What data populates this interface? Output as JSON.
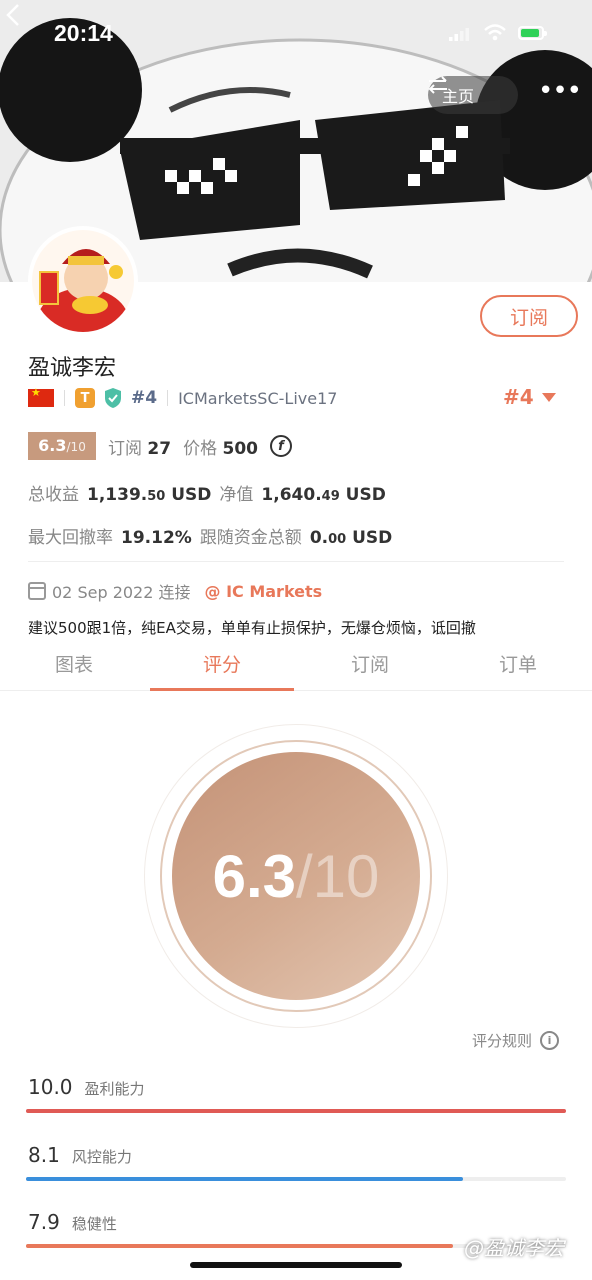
{
  "status_bar": {
    "time": "20:14"
  },
  "nav": {
    "home_label": "主页"
  },
  "profile": {
    "subscribe_label": "订阅",
    "name": "盈诚李宏",
    "rank_small": "#4",
    "server": "ICMarketsSC-Live17",
    "rank_big": "#4",
    "tier_badge": "T"
  },
  "stats": {
    "score": "6.3",
    "score_den": "/10",
    "subs_label": "订阅",
    "subs_value": "27",
    "price_label": "价格",
    "price_value": "500",
    "coin_symbol": "f",
    "total_income_label": "总收益",
    "total_income_int": "1,139.",
    "total_income_dec": "50",
    "currency": "USD",
    "net_label": "净值",
    "net_int": "1,640.",
    "net_dec": "49",
    "max_dd_label": "最大回撤率",
    "max_dd_value": "19.12%",
    "follow_label": "跟随资金总额",
    "follow_int": "0.",
    "follow_dec": "00"
  },
  "connection": {
    "date": "02 Sep 2022 连接",
    "broker": "@ IC Markets"
  },
  "description": "建议500跟1倍，纯EA交易，单单有止损保护，无爆仓烦恼，诋回撤",
  "tabs": [
    {
      "label": "图表"
    },
    {
      "label": "评分"
    },
    {
      "label": "订阅"
    },
    {
      "label": "订单"
    }
  ],
  "active_tab": "评分",
  "score_circle": {
    "score": "6.3",
    "den": "/10"
  },
  "rules_label": "评分规则",
  "metrics": [
    {
      "value": "10.0",
      "label": "盈利能力",
      "fraction": 1.0,
      "color": "#e05a55"
    },
    {
      "value": "8.1",
      "label": "风控能力",
      "fraction": 0.81,
      "color": "#3a8fdc"
    },
    {
      "value": "7.9",
      "label": "稳健性",
      "fraction": 0.79,
      "color": "#e8785a"
    }
  ],
  "watermark": "@盈诚李宏"
}
